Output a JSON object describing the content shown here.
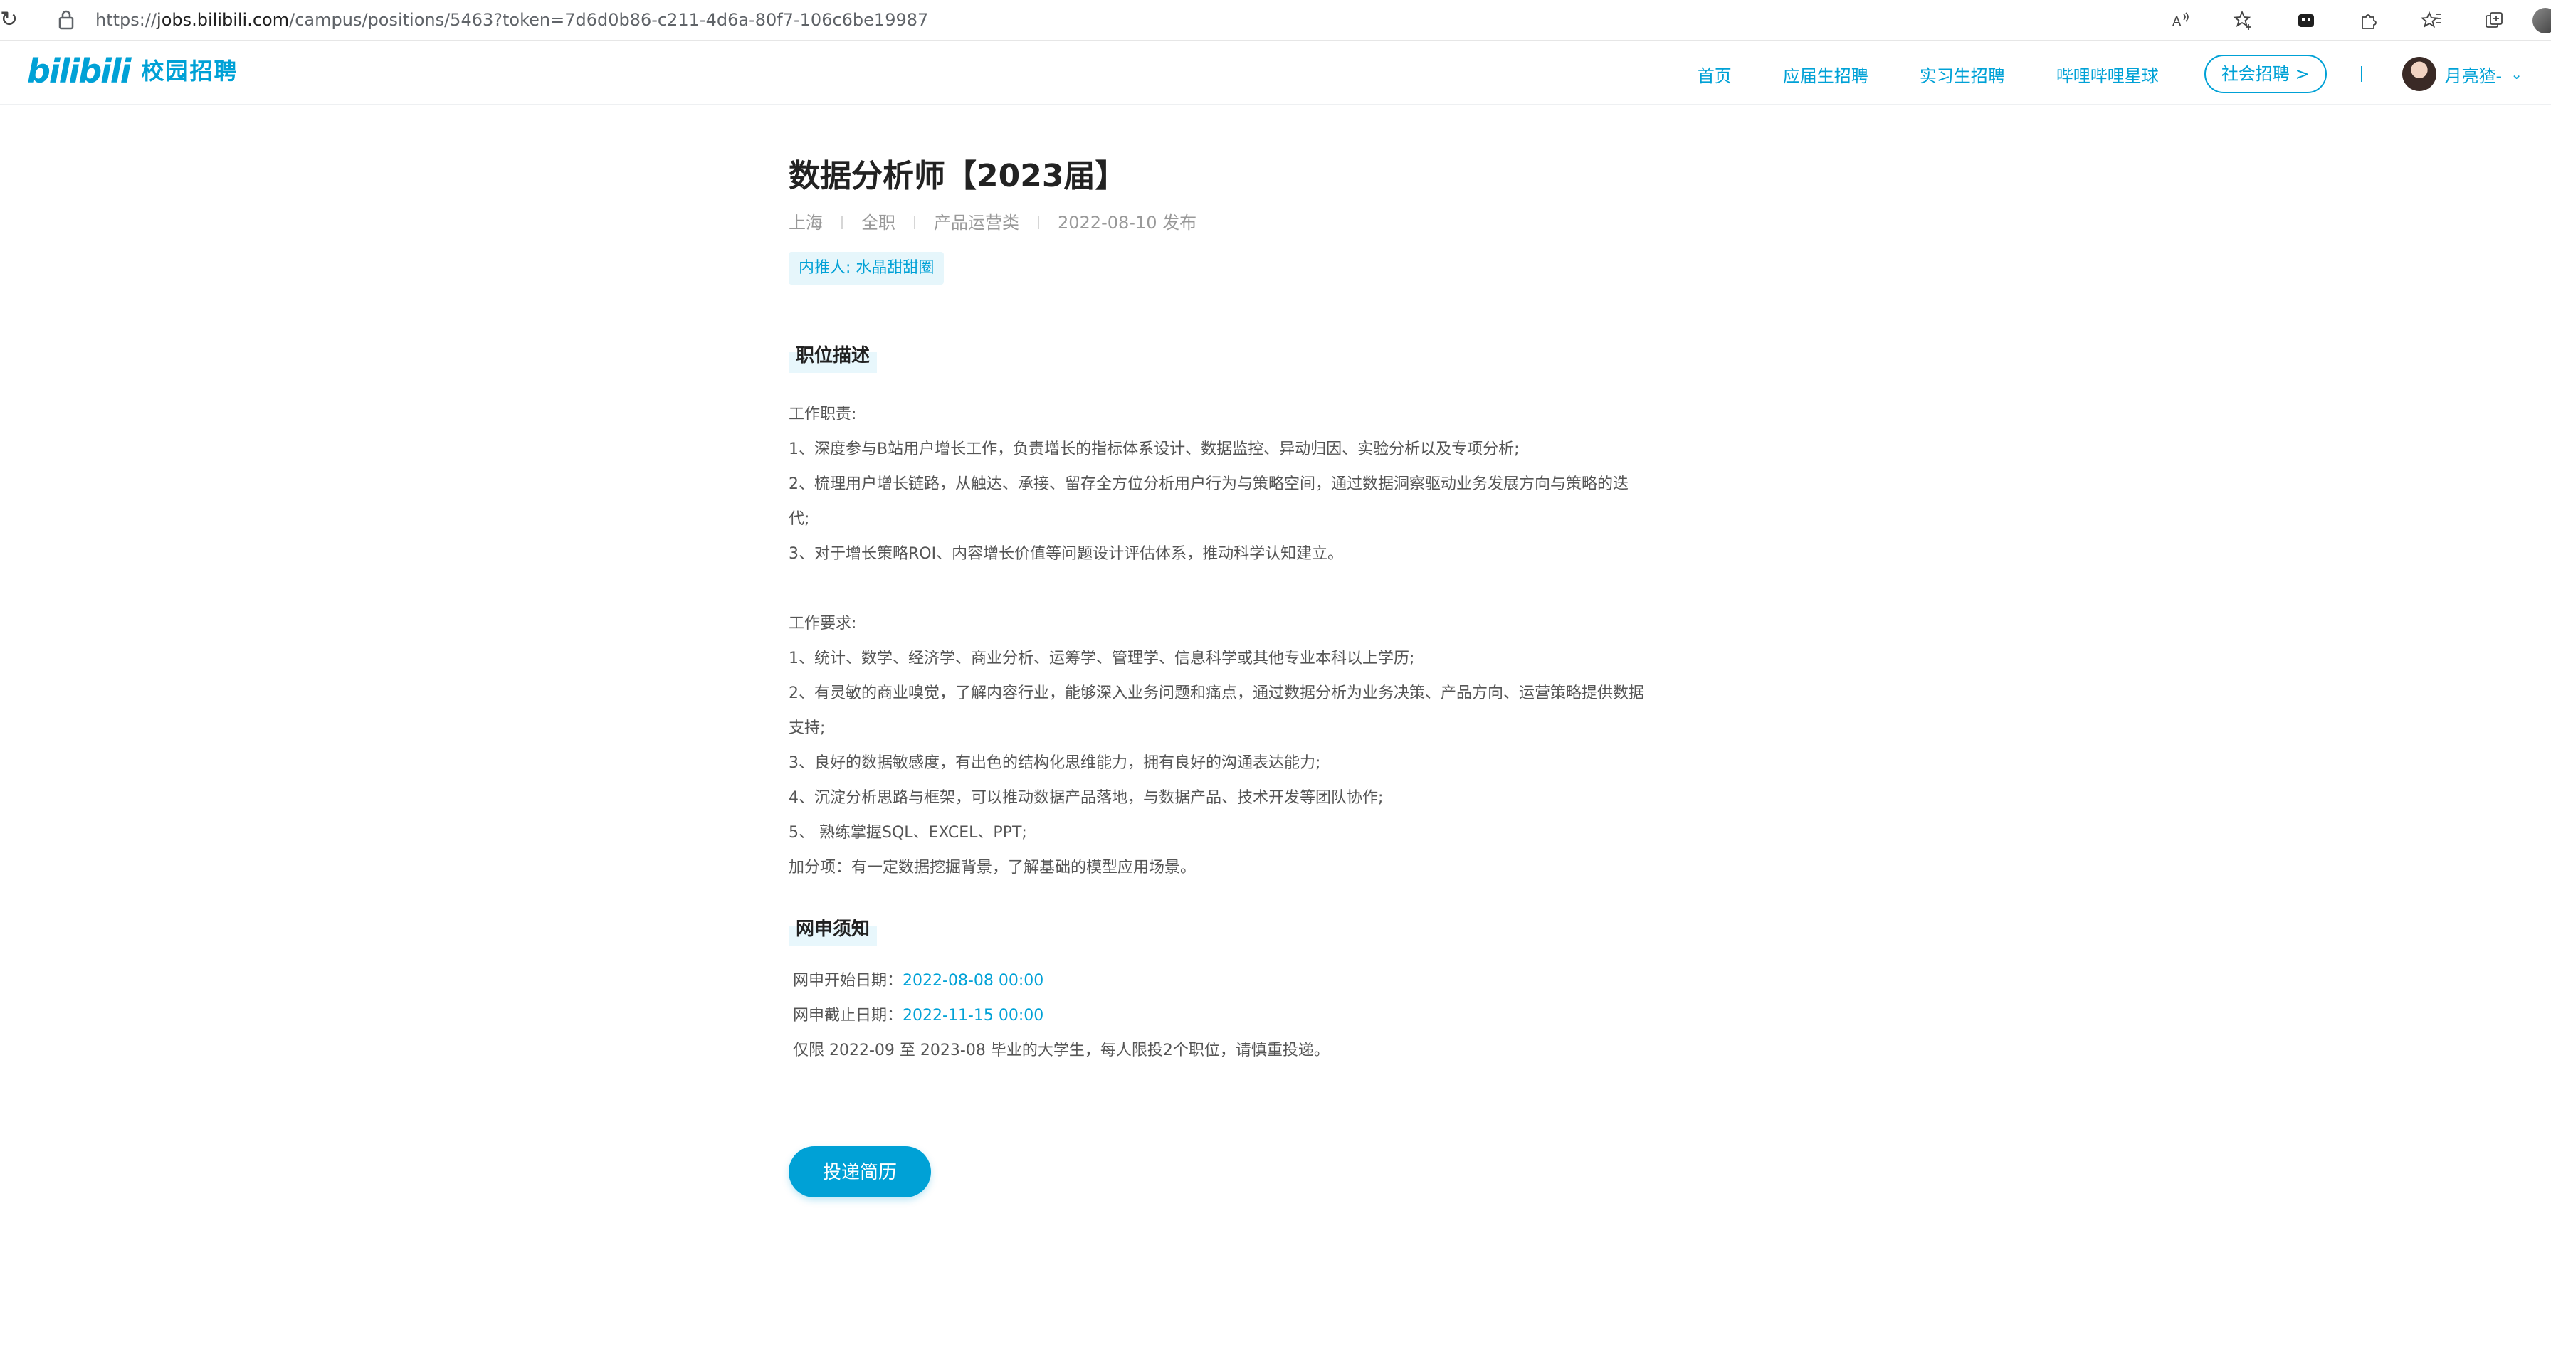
{
  "browser": {
    "url_prefix": "https://",
    "url_host": "jobs.bilibili.com",
    "url_path": "/campus/positions/5463?token=7d6d0b86-c211-4d6a-80f7-106c6be19987"
  },
  "header": {
    "logo_brand": "bilibili",
    "logo_sub": "校园招聘",
    "nav": [
      "首页",
      "应届生招聘",
      "实习生招聘",
      "哔哩哔哩星球"
    ],
    "social_recruit": "社会招聘 >",
    "user_name": "月亮猹-"
  },
  "job": {
    "title": "数据分析师【2023届】",
    "meta": [
      "上海",
      "全职",
      "产品运营类",
      "2022-08-10 发布"
    ],
    "referrer": "内推人: 水晶甜甜圈"
  },
  "description": {
    "title": "职位描述",
    "lines": [
      "工作职责:",
      "1、深度参与B站用户增长工作，负责增长的指标体系设计、数据监控、异动归因、实验分析以及专项分析;",
      "2、梳理用户增长链路，从触达、承接、留存全方位分析用户行为与策略空间，通过数据洞察驱动业务发展方向与策略的迭",
      "代;",
      "3、对于增长策略ROI、内容增长价值等问题设计评估体系，推动科学认知建立。",
      "",
      "工作要求:",
      "1、统计、数学、经济学、商业分析、运筹学、管理学、信息科学或其他专业本科以上学历;",
      "2、有灵敏的商业嗅觉，了解内容行业，能够深入业务问题和痛点，通过数据分析为业务决策、产品方向、运营策略提供数据",
      "支持;",
      "3、良好的数据敏感度，有出色的结构化思维能力，拥有良好的沟通表达能力;",
      "4、沉淀分析思路与框架，可以推动数据产品落地，与数据产品、技术开发等团队协作;",
      "5、 熟练掌握SQL、EXCEL、PPT;",
      "加分项：有一定数据挖掘背景，了解基础的模型应用场景。"
    ]
  },
  "notice": {
    "title": "网申须知",
    "start_label": "网申开始日期：",
    "start_date": "2022-08-08 00:00",
    "end_label": "网申截止日期：",
    "end_date": "2022-11-15 00:00",
    "rule": "仅限 2022-09 至 2023-08 毕业的大学生，每人限投2个职位，请慎重投递。"
  },
  "apply_button": "投递简历",
  "colors": {
    "accent": "#00a1d6",
    "title": "#222222",
    "body": "#555555",
    "meta": "#999999"
  }
}
